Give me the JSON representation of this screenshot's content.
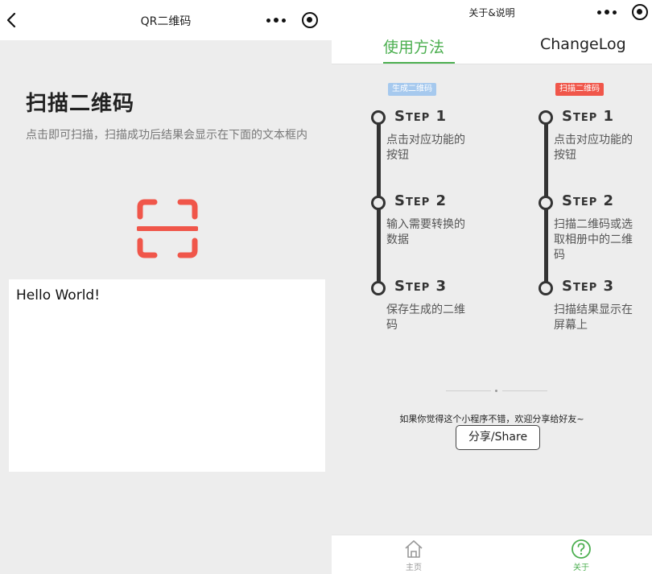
{
  "left": {
    "nav_title": "QR二维码",
    "scan_title": "扫描二维码",
    "scan_desc": "点击即可扫描，扫描成功后结果会显示在下面的文本框内",
    "result_text": "Hello World!",
    "accent_color": "#f0564a"
  },
  "right": {
    "nav_title": "关于&说明",
    "tabs": [
      {
        "label": "使用方法",
        "active": true
      },
      {
        "label": "ChangeLog",
        "active": false
      }
    ],
    "columns": [
      {
        "badge": "生成二维码",
        "badge_color": "#a6c9ee",
        "steps": [
          {
            "title": "Step 1",
            "text": "点击对应功能的按钮"
          },
          {
            "title": "Step 2",
            "text": "输入需要转换的数据"
          },
          {
            "title": "Step 3",
            "text": "保存生成的二维码"
          }
        ]
      },
      {
        "badge": "扫描二维码",
        "badge_color": "#f0564a",
        "steps": [
          {
            "title": "Step 1",
            "text": "点击对应功能的按钮"
          },
          {
            "title": "Step 2",
            "text": "扫描二维码或选取相册中的二维码"
          },
          {
            "title": "Step 3",
            "text": "扫描结果显示在屏幕上"
          }
        ]
      }
    ],
    "share_hint": "如果你觉得这个小程序不错，欢迎分享给好友~",
    "share_button": "分享/Share",
    "tabbar": [
      {
        "label": "主页",
        "icon": "home-icon",
        "active": false
      },
      {
        "label": "关于",
        "icon": "help-icon",
        "active": true
      }
    ],
    "active_color": "#4caf50"
  }
}
